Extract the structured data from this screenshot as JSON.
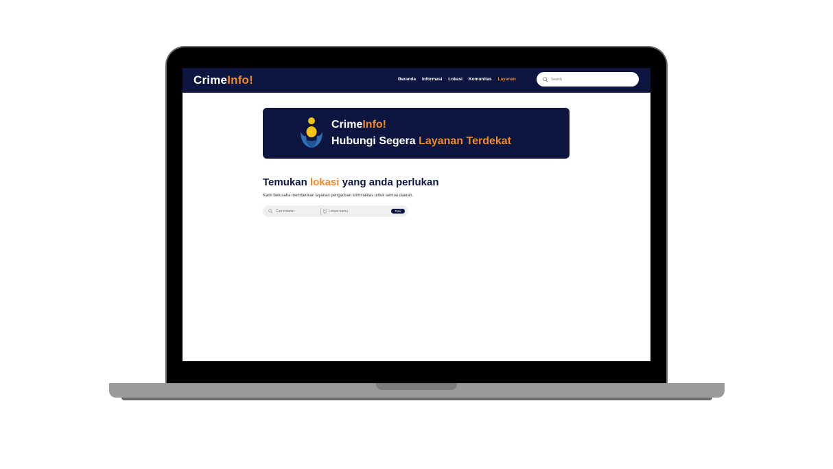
{
  "navbar": {
    "brand_main": "Crime",
    "brand_accent": "Info!",
    "menu": [
      "Beranda",
      "Informasi",
      "Lokasi",
      "Komunitas",
      "Layanan"
    ],
    "active_item": "Layanan",
    "search_placeholder": "Search"
  },
  "banner": {
    "title_main": "Crime",
    "title_accent": "Info!",
    "subtitle_main": "Hubungi Segera ",
    "subtitle_accent": "Layanan Terdekat"
  },
  "content": {
    "heading_before": "Temukan ",
    "heading_accent": "lokasi",
    "heading_after": " yang anda perlukan",
    "subtext": "Kami berusaha memberikan layanan pengaduan kriminalitas untuk semua daerah."
  },
  "finder": {
    "keyword_placeholder": "Cari kotamu",
    "location_placeholder": "Lokasi kamu",
    "button_label": "Cari"
  },
  "colors": {
    "navy": "#0c1640",
    "orange": "#f08a2c"
  }
}
